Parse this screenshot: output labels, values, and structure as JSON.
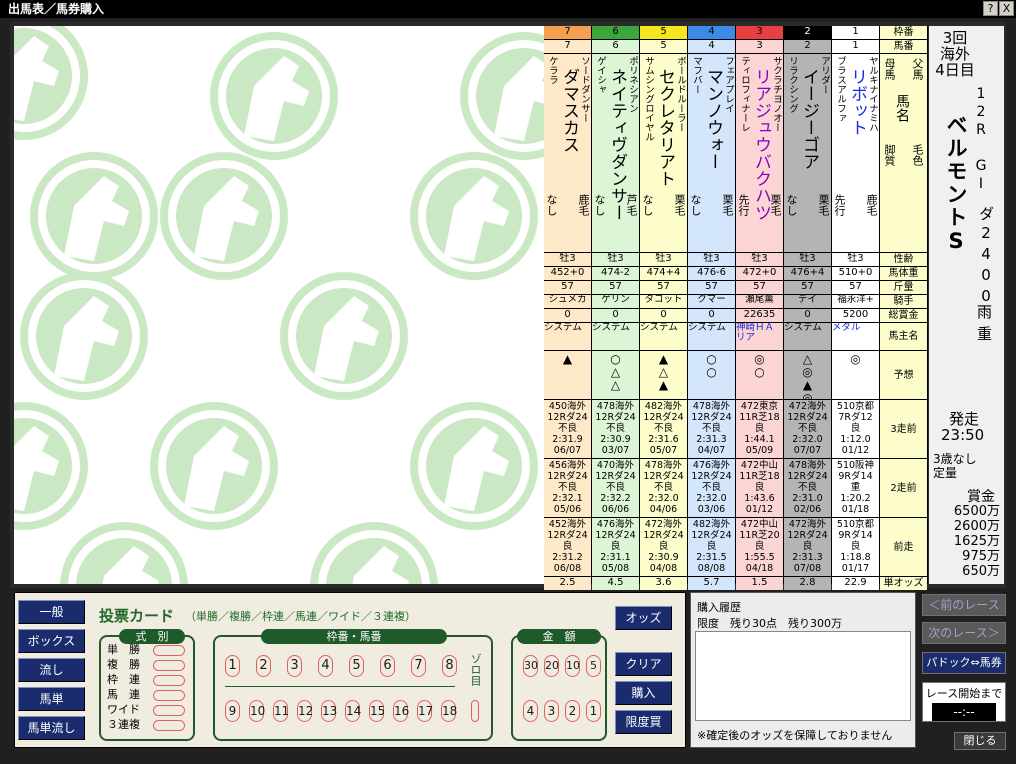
{
  "window": {
    "title": "出馬表／馬券購入",
    "help": "?",
    "close": "X"
  },
  "race": {
    "meet": "3回",
    "venue": "海外",
    "day": "4日目",
    "race_no": "12R",
    "grade": "GI",
    "name": "ベルモントS",
    "course": "ダ2400",
    "weather": "雨",
    "going": "重",
    "post_label": "発走",
    "post_time": "23:50",
    "cond1": "3歳なし",
    "cond2": "定量",
    "prize_label": "賞金",
    "prizes": [
      "6500万",
      "2600万",
      "1625万",
      "975万",
      "650万"
    ]
  },
  "row_labels": {
    "waku": "枠番",
    "umaban": "馬番",
    "sire_dam_a": "父馬",
    "sire_dam_b": "母馬",
    "name": "馬名",
    "color": "毛色",
    "kyaku": "脚質",
    "sex": "性齢",
    "weight": "馬体重",
    "kinryo": "斤量",
    "jockey": "騎手",
    "earnings": "総賞金",
    "owner": "馬主名",
    "yoso": "予想",
    "r3": "3走前",
    "r2": "2走前",
    "r1": "前走",
    "odds": "単オッズ"
  },
  "horses": [
    {
      "waku": "7",
      "umaban": "7",
      "waku_bg": "#f5a050",
      "sire": "ソードダンサー",
      "dam": "ケララ",
      "name": "ダマスカス",
      "name_color": "#000",
      "kyaku": "なし",
      "color": "鹿毛",
      "sex": "牡3",
      "weight": "452+0",
      "kinryo": "57",
      "jockey": "シュメカ",
      "earn": "0",
      "owner": "システム",
      "owner_color": "#000",
      "yoso": "▲",
      "r3": [
        "450海外",
        "12Rダ24",
        "不良",
        "2:31.9",
        "06/07"
      ],
      "r2": [
        "456海外",
        "12Rダ24",
        "不良",
        "2:32.1",
        "05/06"
      ],
      "r1": [
        "452海外",
        "12Rダ24",
        "良",
        "2:31.2",
        "06/08"
      ],
      "odds": "2.5",
      "bg": "#fde9c8"
    },
    {
      "waku": "6",
      "umaban": "6",
      "waku_bg": "#3ca53c",
      "sire": "ポリネシアン",
      "dam": "ゲイシャ",
      "name": "ネイティヴダンサー",
      "name_color": "#000",
      "kyaku": "なし",
      "color": "芦毛",
      "sex": "牡3",
      "weight": "474-2",
      "kinryo": "57",
      "jockey": "ゲリン",
      "earn": "0",
      "owner": "システム",
      "owner_color": "#000",
      "yoso": "○△△",
      "r3": [
        "478海外",
        "12Rダ24",
        "不良",
        "2:30.9",
        "03/07"
      ],
      "r2": [
        "470海外",
        "12Rダ24",
        "不良",
        "2:32.2",
        "06/06"
      ],
      "r1": [
        "476海外",
        "12Rダ24",
        "良",
        "2:31.1",
        "05/08"
      ],
      "odds": "4.5",
      "bg": "#dcf5d4"
    },
    {
      "waku": "5",
      "umaban": "5",
      "waku_bg": "#f5e620",
      "sire": "ボールドルーラー",
      "dam": "サムシングロイヤル",
      "name": "セクレタリアト",
      "name_color": "#000",
      "kyaku": "なし",
      "color": "栗毛",
      "sex": "牡3",
      "weight": "474+4",
      "kinryo": "57",
      "jockey": "タコット",
      "earn": "0",
      "owner": "システム",
      "owner_color": "#000",
      "yoso": "▲△▲",
      "r3": [
        "482海外",
        "12Rダ24",
        "不良",
        "2:31.6",
        "05/07"
      ],
      "r2": [
        "478海外",
        "12Rダ24",
        "不良",
        "2:32.0",
        "04/06"
      ],
      "r1": [
        "472海外",
        "12Rダ24",
        "良",
        "2:30.9",
        "04/08"
      ],
      "odds": "3.6",
      "bg": "#fdfccb"
    },
    {
      "waku": "4",
      "umaban": "4",
      "waku_bg": "#3c8ce6",
      "sire": "フェアプレイ",
      "dam": "マフバー",
      "name": "マンノウォー",
      "name_color": "#000",
      "kyaku": "なし",
      "color": "栗毛",
      "sex": "牡3",
      "weight": "476-6",
      "kinryo": "57",
      "jockey": "クマー",
      "earn": "0",
      "owner": "システム",
      "owner_color": "#000",
      "yoso": "○○",
      "r3": [
        "478海外",
        "12Rダ24",
        "不良",
        "2:31.3",
        "04/07"
      ],
      "r2": [
        "476海外",
        "12Rダ24",
        "不良",
        "2:32.0",
        "03/06"
      ],
      "r1": [
        "482海外",
        "12Rダ24",
        "良",
        "2:31.5",
        "08/08"
      ],
      "odds": "5.7",
      "bg": "#d4e6fb"
    },
    {
      "waku": "3",
      "umaban": "3",
      "waku_bg": "#e84040",
      "sire": "サクラチヨノオー",
      "dam": "ティロフィナーレ",
      "name": "リアジュウバクハツ",
      "name_color": "#8a00c8",
      "kyaku": "先行",
      "color": "栗毛",
      "sex": "牡3",
      "weight": "472+0",
      "kinryo": "57",
      "jockey": "瀬尾薫",
      "earn": "22635",
      "owner": "神崎ＨＡリア",
      "owner_color": "#1a2cd8",
      "yoso": "◎○",
      "r3": [
        "472東京",
        "11R芝18",
        "良",
        "1:44.1",
        "05/09"
      ],
      "r2": [
        "472中山",
        "11R芝18",
        "良",
        "1:43.6",
        "01/12"
      ],
      "r1": [
        "472中山",
        "11R芝20",
        "良",
        "1:55.5",
        "04/18"
      ],
      "odds": "1.5",
      "bg": "#fbd4d4"
    },
    {
      "waku": "2",
      "umaban": "2",
      "waku_bg": "#000000",
      "sire": "アリダー",
      "dam": "リラクシング",
      "name": "イージーゴア",
      "name_color": "#000",
      "kyaku": "なし",
      "color": "栗毛",
      "sex": "牡3",
      "weight": "476+4",
      "kinryo": "57",
      "jockey": "デイ",
      "earn": "0",
      "owner": "システム",
      "owner_color": "#000",
      "yoso": "△◎▲◎",
      "r3": [
        "472海外",
        "12Rダ24",
        "不良",
        "2:32.0",
        "07/07"
      ],
      "r2": [
        "478海外",
        "12Rダ24",
        "不良",
        "2:31.0",
        "02/06"
      ],
      "r1": [
        "472海外",
        "12Rダ24",
        "良",
        "2:31.3",
        "07/08"
      ],
      "odds": "2.8",
      "bg": "#b4b4b4"
    },
    {
      "waku": "1",
      "umaban": "1",
      "waku_bg": "#ffffff",
      "sire": "ヤルキナイナミハ",
      "dam": "ブラスアルファ",
      "name": "リボット",
      "name_color": "#1a2cd8",
      "kyaku": "先行",
      "color": "鹿毛",
      "sex": "牡3",
      "weight": "510+0",
      "kinryo": "57",
      "jockey": "福永洋+",
      "earn": "5200",
      "owner": "メダル",
      "owner_color": "#1a2cd8",
      "yoso": "◎",
      "r3": [
        "510京都",
        "7Rダ12",
        "良",
        "1:12.0",
        "01/12"
      ],
      "r2": [
        "510阪神",
        "9Rダ14",
        "重",
        "1:20.2",
        "01/18"
      ],
      "r1": [
        "510京都",
        "9Rダ14",
        "良",
        "1:18.8",
        "01/17"
      ],
      "odds": "22.9",
      "bg": "#ffffff"
    }
  ],
  "left_buttons": [
    "一般",
    "ボックス",
    "流し",
    "馬単",
    "馬単流し"
  ],
  "card": {
    "title": "投票カード",
    "subtitle": "（単勝／複勝／枠連／馬連／ワイド／３連複）",
    "shiki_label": "式　別",
    "bets": [
      "単　勝",
      "複　勝",
      "枠　連",
      "馬　連",
      "ワイド",
      "３連複"
    ],
    "wakuban_label": "枠番・馬番",
    "nums_top": [
      "1",
      "2",
      "3",
      "4",
      "5",
      "6",
      "7",
      "8"
    ],
    "nums_bottom": [
      "9",
      "10",
      "11",
      "12",
      "13",
      "14",
      "15",
      "16",
      "17",
      "18"
    ],
    "zoro": "ゾロ目",
    "kingaku_label": "金　額",
    "amt_top": [
      "30",
      "20",
      "10",
      "5"
    ],
    "amt_bottom": [
      "4",
      "3",
      "2",
      "1"
    ]
  },
  "right_buttons": [
    "オッズ",
    "クリア",
    "購入",
    "限度買"
  ],
  "history": {
    "title": "購入履歴",
    "limit": "限度　残り30点　残り300万",
    "note": "※確定後のオッズを保障しておりません"
  },
  "nav": {
    "prev": "＜前のレース",
    "next": "次のレース＞",
    "paddock": "パドック⇔馬券",
    "start_label": "レース開始まで",
    "countdown": "--:--",
    "close": "閉じる"
  }
}
